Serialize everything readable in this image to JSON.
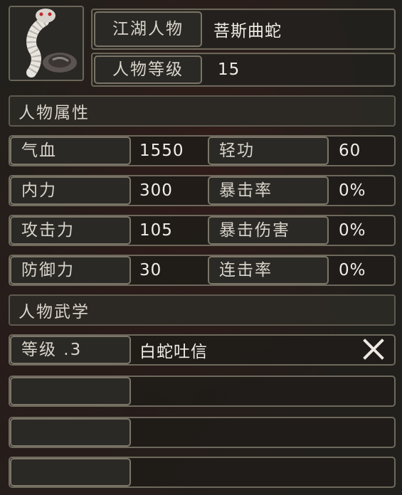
{
  "header": {
    "name_label": "江湖人物",
    "name_value": "菩斯曲蛇",
    "level_label": "人物等级",
    "level_value": "15"
  },
  "attributes_title": "人物属性",
  "attributes": [
    {
      "label": "气血",
      "value": "1550"
    },
    {
      "label": "轻功",
      "value": "60"
    },
    {
      "label": "内力",
      "value": "300"
    },
    {
      "label": "暴击率",
      "value": "0%"
    },
    {
      "label": "攻击力",
      "value": "105"
    },
    {
      "label": "暴击伤害",
      "value": "0%"
    },
    {
      "label": "防御力",
      "value": "30"
    },
    {
      "label": "连击率",
      "value": "0%"
    }
  ],
  "skills_title": "人物武学",
  "skills": [
    {
      "level": "等级 .3",
      "name": "白蛇吐信"
    },
    {
      "level": "",
      "name": ""
    },
    {
      "level": "",
      "name": ""
    },
    {
      "level": "",
      "name": ""
    }
  ],
  "icons": {
    "portrait": "white-snake-portrait",
    "remove": "close-icon"
  }
}
